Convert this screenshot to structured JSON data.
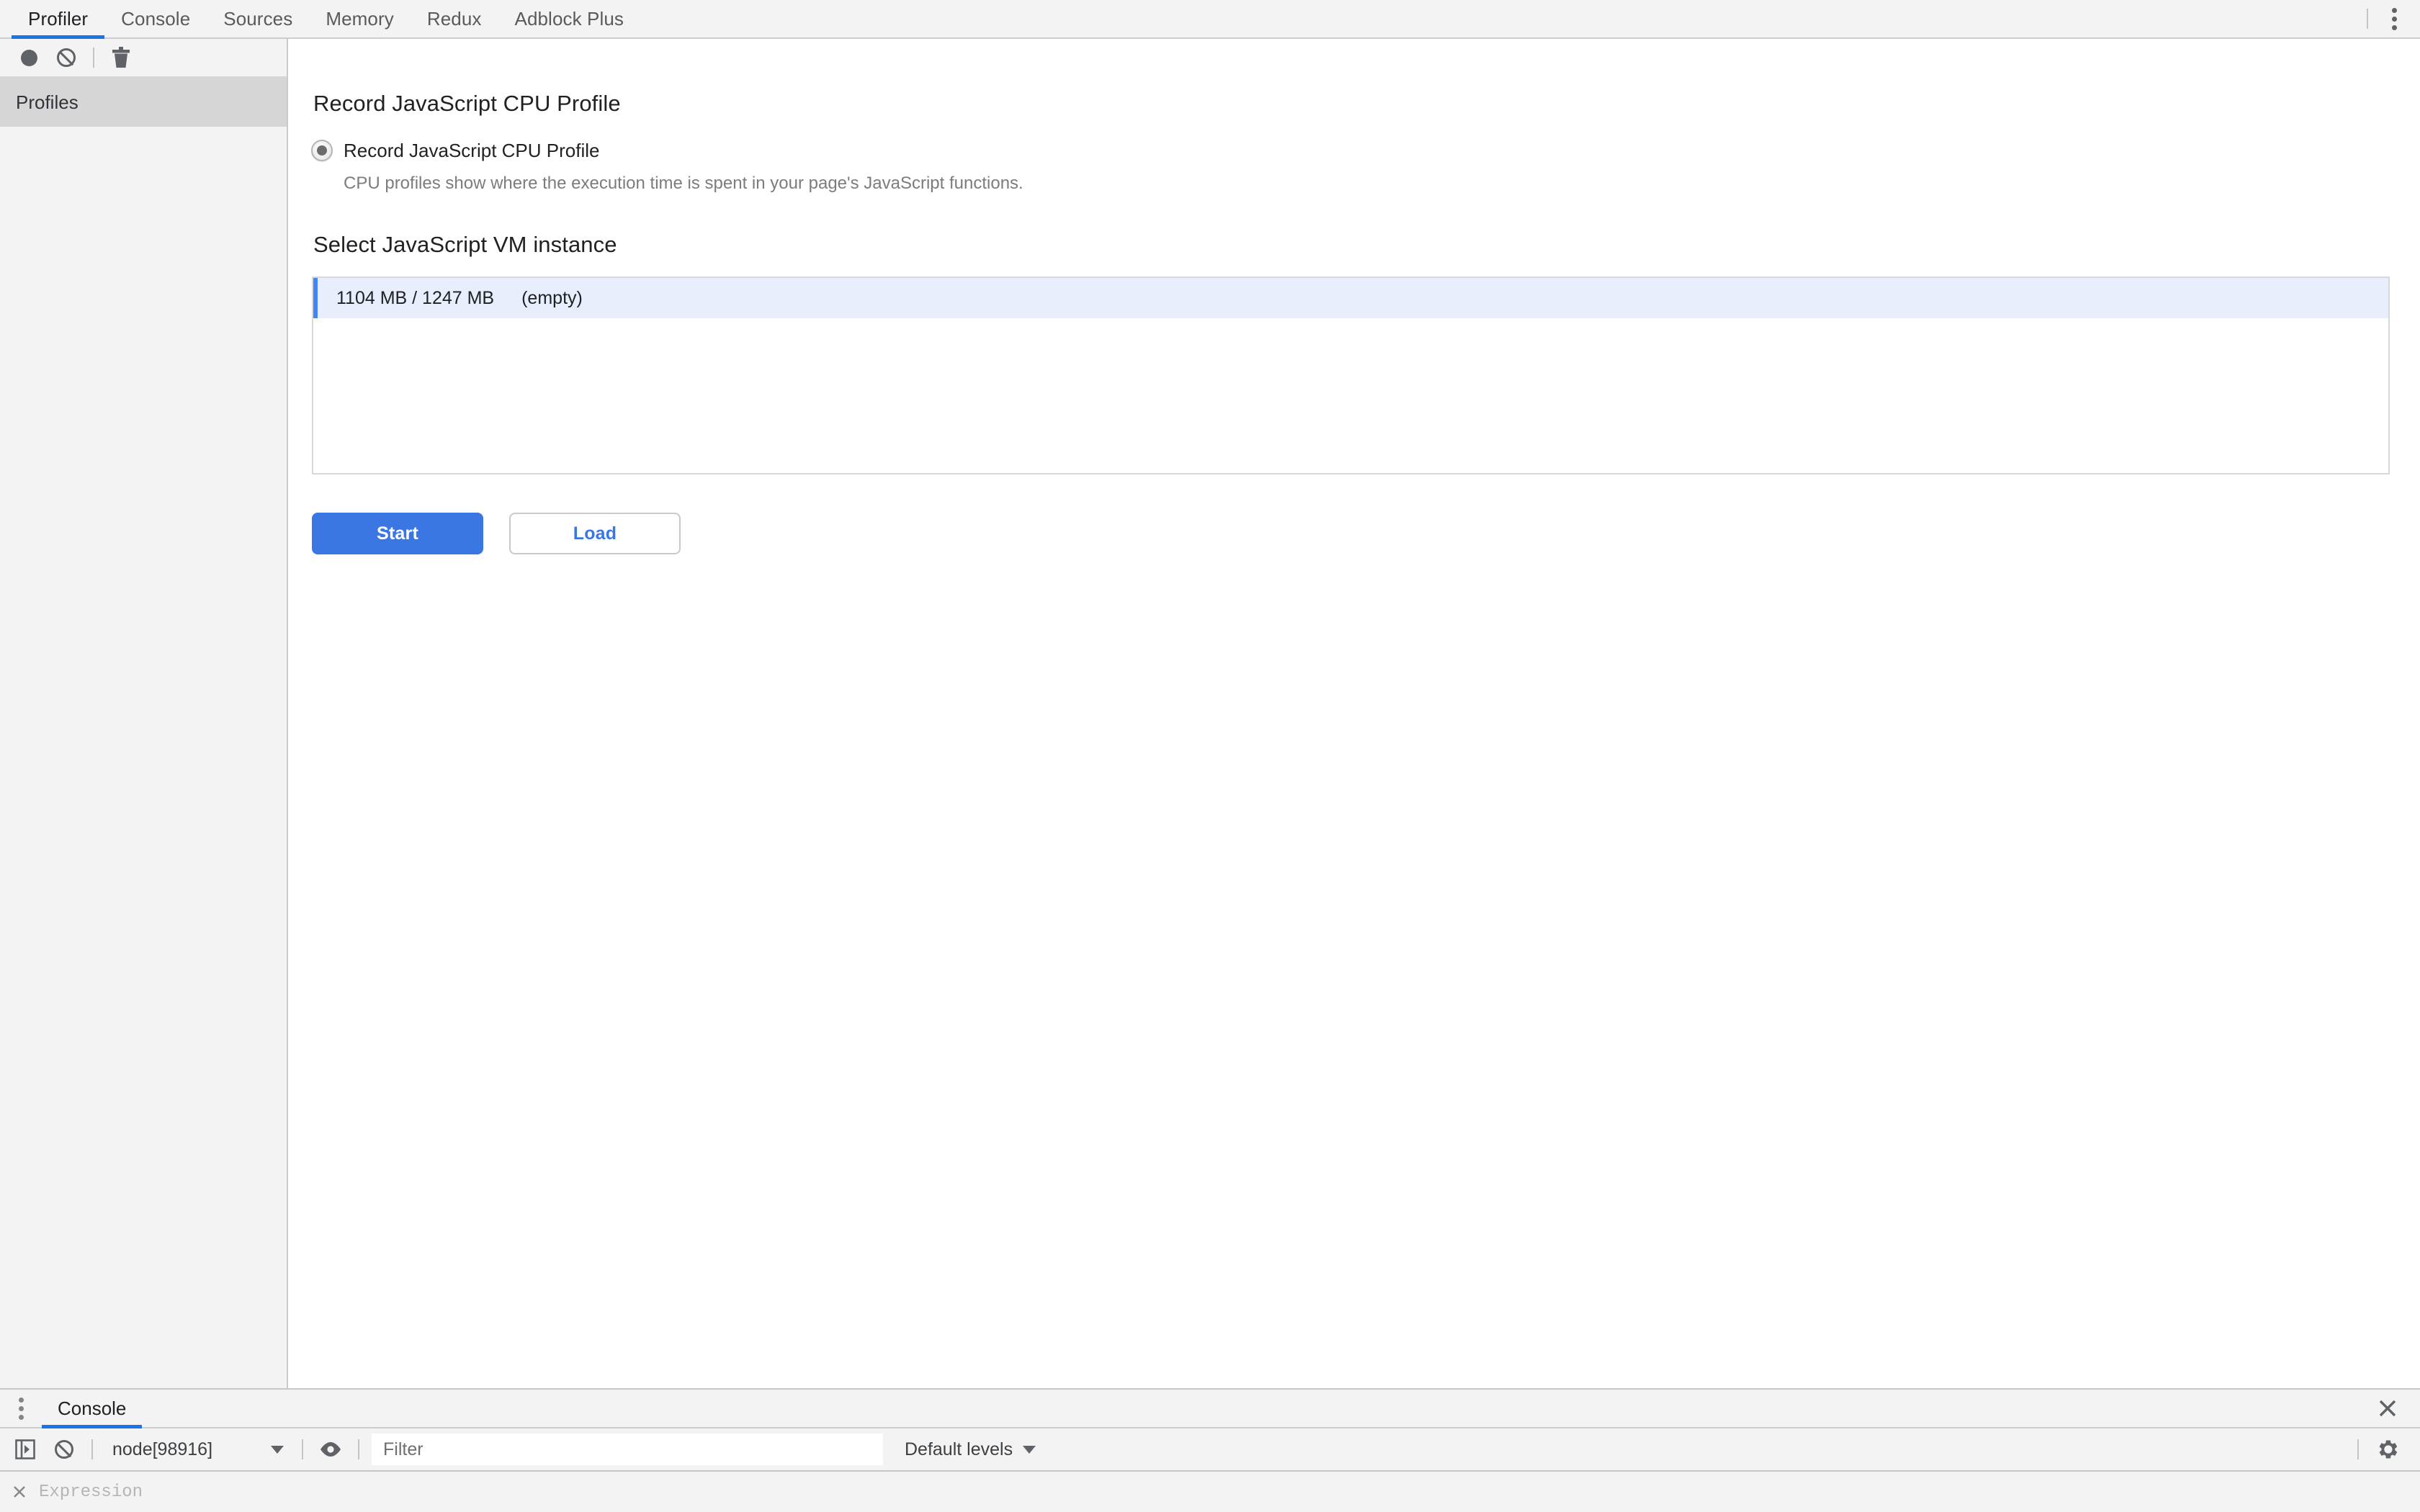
{
  "window": {
    "tabs": [
      {
        "label": "Profiler",
        "active": true
      },
      {
        "label": "Console",
        "active": false
      },
      {
        "label": "Sources",
        "active": false
      },
      {
        "label": "Memory",
        "active": false
      },
      {
        "label": "Redux",
        "active": false
      },
      {
        "label": "Adblock Plus",
        "active": false
      }
    ],
    "more_icon": "kebab-menu-icon",
    "accent_color": "#1a73e8"
  },
  "sidebar": {
    "toolbar": {
      "record_icon": "record-circle-icon",
      "clear_icon": "clear-no-entry-icon",
      "delete_icon": "trash-icon"
    },
    "items": [
      {
        "label": "Profiles",
        "selected": true
      }
    ]
  },
  "main": {
    "section_title": "Record JavaScript CPU Profile",
    "radio": {
      "label": "Record JavaScript CPU Profile",
      "checked": true,
      "description": "CPU profiles show where the execution time is spent in your page's JavaScript functions."
    },
    "vm_section_title": "Select JavaScript VM instance",
    "vm_instances": [
      {
        "memory": "1104 MB / 1247 MB",
        "state": "(empty)",
        "selected": true
      }
    ],
    "buttons": {
      "start": "Start",
      "load": "Load",
      "primary_color": "#3b77e3"
    }
  },
  "drawer": {
    "more_icon": "kebab-menu-icon",
    "tabs": [
      {
        "label": "Console",
        "active": true
      }
    ],
    "close_icon": "close-icon",
    "toolbar": {
      "sidebar_toggle_icon": "show-console-sidebar-icon",
      "clear_icon": "clear-console-icon",
      "context_selected": "node[98916]",
      "context_caret_icon": "chevron-down-icon",
      "live_expression_icon": "eye-icon",
      "filter_placeholder": "Filter",
      "levels_label": "Default levels",
      "levels_caret_icon": "chevron-down-icon",
      "settings_icon": "gear-icon"
    },
    "prompt": {
      "close_icon": "close-small-icon",
      "placeholder": "Expression"
    }
  }
}
